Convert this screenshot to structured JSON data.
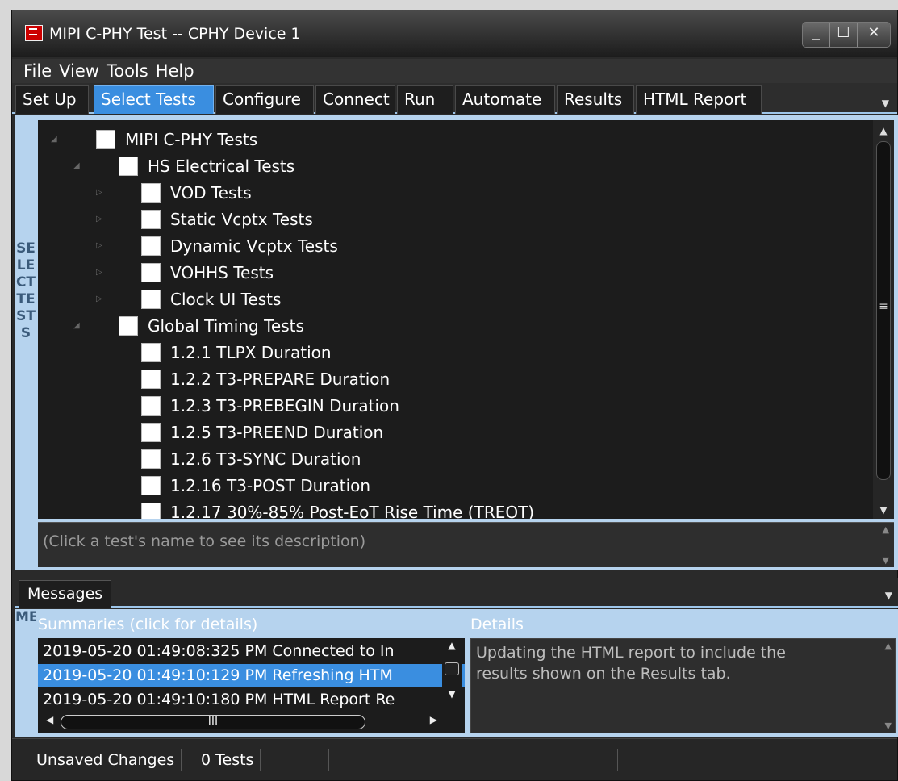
{
  "window": {
    "title": "MIPI C-PHY Test -- CPHY Device 1"
  },
  "menu": [
    "File",
    "View",
    "Tools",
    "Help"
  ],
  "tabs": [
    "Set Up",
    "Select Tests",
    "Configure",
    "Connect",
    "Run",
    "Automate",
    "Results",
    "HTML Report"
  ],
  "active_tab": "Select Tests",
  "select_tests": {
    "side_label": "SELECT TESTS",
    "tree": [
      {
        "label": "MIPI C-PHY Tests",
        "level": 0,
        "expander": "expanded",
        "checked": false
      },
      {
        "label": "HS Electrical Tests",
        "level": 1,
        "expander": "expanded",
        "checked": false
      },
      {
        "label": "VOD Tests",
        "level": 2,
        "expander": "collapsed",
        "checked": false
      },
      {
        "label": "Static Vcptx Tests",
        "level": 2,
        "expander": "collapsed",
        "checked": false
      },
      {
        "label": "Dynamic Vcptx Tests",
        "level": 2,
        "expander": "collapsed",
        "checked": false
      },
      {
        "label": "VOHHS Tests",
        "level": 2,
        "expander": "collapsed",
        "checked": false
      },
      {
        "label": "Clock UI Tests",
        "level": 2,
        "expander": "collapsed",
        "checked": false
      },
      {
        "label": "Global Timing Tests",
        "level": 1,
        "expander": "expanded",
        "checked": false
      },
      {
        "label": "1.2.1 TLPX Duration",
        "level": 2,
        "expander": "none",
        "checked": false
      },
      {
        "label": "1.2.2 T3-PREPARE Duration",
        "level": 2,
        "expander": "none",
        "checked": false
      },
      {
        "label": "1.2.3 T3-PREBEGIN Duration",
        "level": 2,
        "expander": "none",
        "checked": false
      },
      {
        "label": "1.2.5 T3-PREEND Duration",
        "level": 2,
        "expander": "none",
        "checked": false
      },
      {
        "label": "1.2.6 T3-SYNC Duration",
        "level": 2,
        "expander": "none",
        "checked": false
      },
      {
        "label": "1.2.16 T3-POST Duration",
        "level": 2,
        "expander": "none",
        "checked": false
      },
      {
        "label": "1.2.17 30%-85% Post-EoT Rise Time (TREOT)",
        "level": 2,
        "expander": "none",
        "checked": false
      }
    ],
    "description_placeholder": "(Click a test's name to see its description)"
  },
  "messages": {
    "tab_label": "Messages",
    "side_label": "MESSAGE",
    "summaries_header": "Summaries (click for details)",
    "details_header": "Details",
    "summaries": [
      "2019-05-20 01:49:08:325 PM Connected to In",
      "2019-05-20 01:49:10:129 PM Refreshing HTM",
      "2019-05-20 01:49:10:180 PM HTML Report Re"
    ],
    "selected_index": 1,
    "details_text": "Updating the HTML report to include the results shown on the Results tab."
  },
  "status_bar": {
    "unsaved": "Unsaved Changes",
    "tests": "0 Tests"
  },
  "colors": {
    "accent": "#3a8ee0",
    "frame": "#b6d3ee",
    "background": "#1c1c1c"
  }
}
